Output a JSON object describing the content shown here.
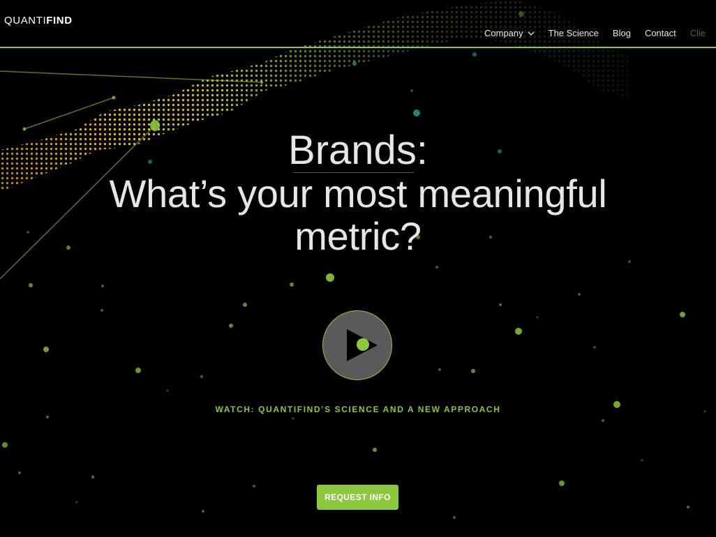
{
  "colors": {
    "background": "#000000",
    "accent": "#8dc63f",
    "text": "#e6e6e6",
    "nav_dim": "#5c5c5c",
    "headline_underline": "#b8322f",
    "play_fill": "#5a5a5a"
  },
  "logo": {
    "light_part": "QUANTI",
    "bold_part": "FIND"
  },
  "nav": {
    "items": [
      {
        "label": "Company",
        "icon": "chevron-down-icon"
      },
      {
        "label": "The Science"
      },
      {
        "label": "Blog"
      },
      {
        "label": "Contact"
      },
      {
        "label": "Clie"
      }
    ]
  },
  "hero": {
    "headline": "Brands:",
    "subheadline_lines": [
      "What’s your most meaningful",
      "metric?"
    ]
  },
  "video": {
    "button_icon": "play-icon",
    "caption": "WATCH: QUANTIFIND’S SCIENCE AND A NEW APPROACH"
  },
  "cta": {
    "label": "REQUEST INFO"
  }
}
